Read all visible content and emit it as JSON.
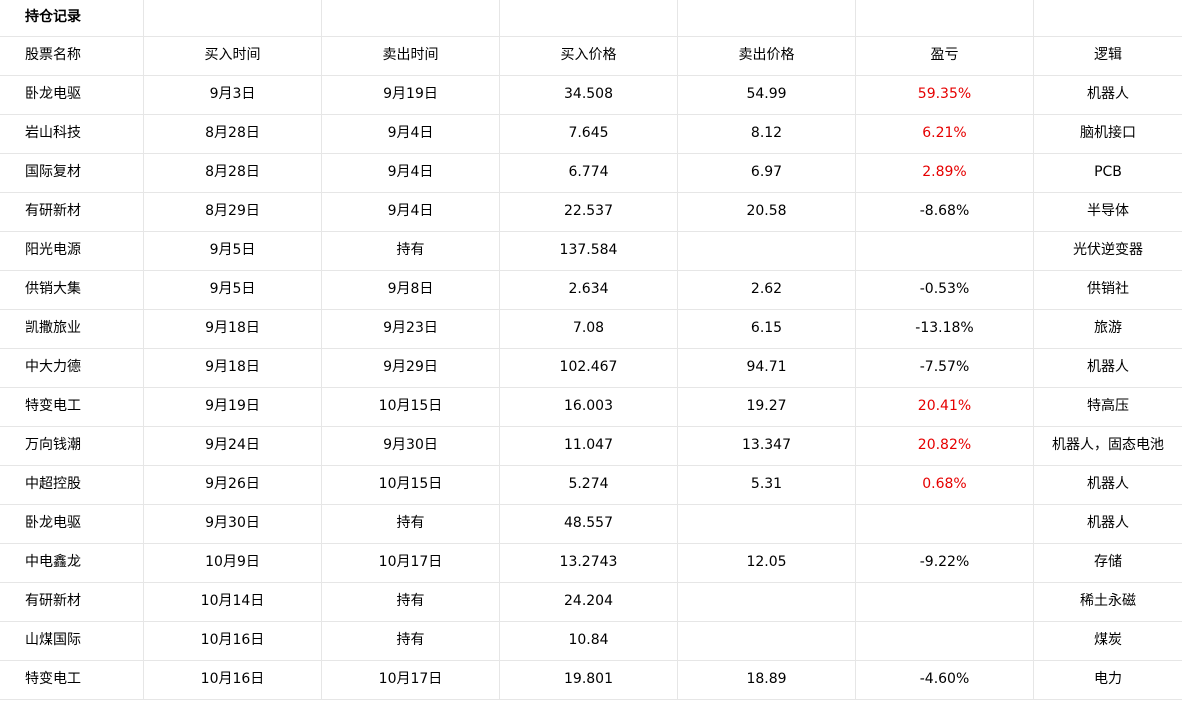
{
  "sheet": {
    "title": "持仓记录",
    "colors": {
      "profit": "#e60000",
      "grid": "#e6e6e6"
    },
    "headers": [
      "股票名称",
      "买入时间",
      "卖出时间",
      "买入价格",
      "卖出价格",
      "盈亏",
      "逻辑"
    ],
    "rows": [
      {
        "name": "卧龙电驱",
        "buy_date": "9月3日",
        "sell_date": "9月19日",
        "buy_price": "34.508",
        "sell_price": "54.99",
        "pnl": "59.35%",
        "positive": true,
        "logic": "机器人"
      },
      {
        "name": "岩山科技",
        "buy_date": "8月28日",
        "sell_date": "9月4日",
        "buy_price": "7.645",
        "sell_price": "8.12",
        "pnl": "6.21%",
        "positive": true,
        "logic": "脑机接口"
      },
      {
        "name": "国际复材",
        "buy_date": "8月28日",
        "sell_date": "9月4日",
        "buy_price": "6.774",
        "sell_price": "6.97",
        "pnl": "2.89%",
        "positive": true,
        "logic": "PCB"
      },
      {
        "name": "有研新材",
        "buy_date": "8月29日",
        "sell_date": "9月4日",
        "buy_price": "22.537",
        "sell_price": "20.58",
        "pnl": "-8.68%",
        "positive": false,
        "logic": "半导体"
      },
      {
        "name": "阳光电源",
        "buy_date": "9月5日",
        "sell_date": "持有",
        "buy_price": "137.584",
        "sell_price": "",
        "pnl": "",
        "positive": false,
        "logic": "光伏逆变器"
      },
      {
        "name": "供销大集",
        "buy_date": "9月5日",
        "sell_date": "9月8日",
        "buy_price": "2.634",
        "sell_price": "2.62",
        "pnl": "-0.53%",
        "positive": false,
        "logic": "供销社"
      },
      {
        "name": "凯撒旅业",
        "buy_date": "9月18日",
        "sell_date": "9月23日",
        "buy_price": "7.08",
        "sell_price": "6.15",
        "pnl": "-13.18%",
        "positive": false,
        "logic": "旅游"
      },
      {
        "name": "中大力德",
        "buy_date": "9月18日",
        "sell_date": "9月29日",
        "buy_price": "102.467",
        "sell_price": "94.71",
        "pnl": "-7.57%",
        "positive": false,
        "logic": "机器人"
      },
      {
        "name": "特变电工",
        "buy_date": "9月19日",
        "sell_date": "10月15日",
        "buy_price": "16.003",
        "sell_price": "19.27",
        "pnl": "20.41%",
        "positive": true,
        "logic": "特高压"
      },
      {
        "name": "万向钱潮",
        "buy_date": "9月24日",
        "sell_date": "9月30日",
        "buy_price": "11.047",
        "sell_price": "13.347",
        "pnl": "20.82%",
        "positive": true,
        "logic": "机器人，固态电池"
      },
      {
        "name": "中超控股",
        "buy_date": "9月26日",
        "sell_date": "10月15日",
        "buy_price": "5.274",
        "sell_price": "5.31",
        "pnl": "0.68%",
        "positive": true,
        "logic": "机器人"
      },
      {
        "name": "卧龙电驱",
        "buy_date": "9月30日",
        "sell_date": "持有",
        "buy_price": "48.557",
        "sell_price": "",
        "pnl": "",
        "positive": false,
        "logic": "机器人"
      },
      {
        "name": "中电鑫龙",
        "buy_date": "10月9日",
        "sell_date": "10月17日",
        "buy_price": "13.2743",
        "sell_price": "12.05",
        "pnl": "-9.22%",
        "positive": false,
        "logic": "存储"
      },
      {
        "name": "有研新材",
        "buy_date": "10月14日",
        "sell_date": "持有",
        "buy_price": "24.204",
        "sell_price": "",
        "pnl": "",
        "positive": false,
        "logic": "稀土永磁"
      },
      {
        "name": "山煤国际",
        "buy_date": "10月16日",
        "sell_date": "持有",
        "buy_price": "10.84",
        "sell_price": "",
        "pnl": "",
        "positive": false,
        "logic": "煤炭"
      },
      {
        "name": "特变电工",
        "buy_date": "10月16日",
        "sell_date": "10月17日",
        "buy_price": "19.801",
        "sell_price": "18.89",
        "pnl": "-4.60%",
        "positive": false,
        "logic": "电力"
      }
    ]
  }
}
